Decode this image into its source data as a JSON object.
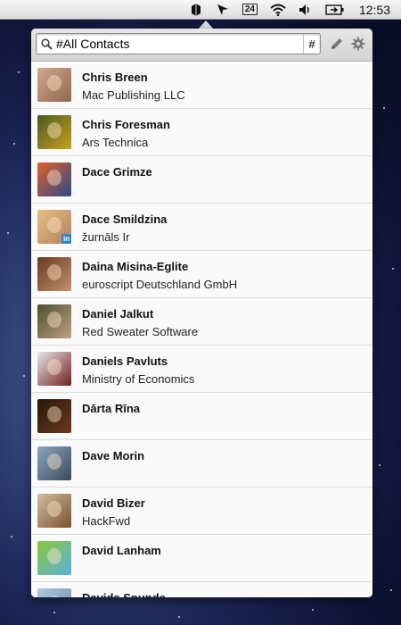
{
  "menubar": {
    "date": "24",
    "clock": "12:53"
  },
  "search": {
    "value": "#All Contacts",
    "hash_label": "#"
  },
  "icons": {
    "search": "search-icon",
    "edit": "pencil-icon",
    "settings": "gear-icon"
  },
  "contacts": [
    {
      "name": "Chris Breen",
      "org": "Mac Publishing LLC",
      "colors": [
        "#d6a78a",
        "#8f6750"
      ]
    },
    {
      "name": "Chris Foresman",
      "org": "Ars Technica",
      "colors": [
        "#4a5a20",
        "#c7a020"
      ]
    },
    {
      "name": "Dace Grimze",
      "org": "",
      "colors": [
        "#e06028",
        "#2a4a8a"
      ]
    },
    {
      "name": "Dace Smildzina",
      "org": "žurnāls Ir",
      "colors": [
        "#e8c080",
        "#b08060"
      ],
      "badge": "in"
    },
    {
      "name": "Daina Misina-Eglite",
      "org": "euroscript Deutschland GmbH",
      "colors": [
        "#6a3a20",
        "#c09070"
      ]
    },
    {
      "name": "Daniel Jalkut",
      "org": "Red Sweater Software",
      "colors": [
        "#4a5030",
        "#c0a080"
      ]
    },
    {
      "name": "Daniels Pavluts",
      "org": "Ministry of Economics",
      "colors": [
        "#e8e8e8",
        "#702020"
      ]
    },
    {
      "name": "Dārta Rīna",
      "org": "",
      "colors": [
        "#2a1808",
        "#6a3a20"
      ]
    },
    {
      "name": "Dave Morin",
      "org": "",
      "colors": [
        "#8aa8c0",
        "#3a4a5a"
      ]
    },
    {
      "name": "David Bizer",
      "org": "HackFwd",
      "colors": [
        "#d0c0a0",
        "#7a5030"
      ]
    },
    {
      "name": "David Lanham",
      "org": "",
      "colors": [
        "#8ac83a",
        "#5ab0e0"
      ]
    },
    {
      "name": "Davids Spunde",
      "org": "",
      "colors": [
        "#b0c8e0",
        "#6a88b0"
      ]
    }
  ]
}
